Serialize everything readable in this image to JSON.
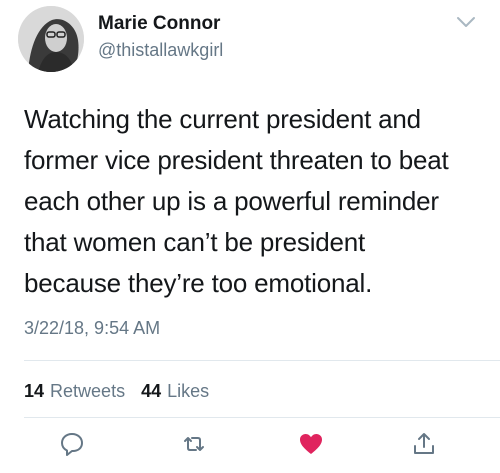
{
  "user": {
    "display_name": "Marie Connor",
    "handle": "@thistallawkgirl",
    "avatar_icon": "profile-photo"
  },
  "tweet": {
    "lines": [
      "Watching the current president and",
      "former vice president threaten to beat",
      "each other up is a powerful reminder",
      "that women can’t be president",
      "because they’re too emotional."
    ],
    "timestamp": "3/22/18, 9:54 AM"
  },
  "stats": {
    "retweets_count": "14",
    "retweets_label": "Retweets",
    "likes_count": "44",
    "likes_label": "Likes"
  },
  "actions": [
    {
      "name": "reply-icon"
    },
    {
      "name": "retweet-icon"
    },
    {
      "name": "like-icon",
      "color": "#e0245e"
    },
    {
      "name": "share-icon"
    }
  ],
  "colors": {
    "secondary_text": "#657786",
    "primary_text": "#14171a",
    "like": "#e0245e",
    "icon_gray": "#657786"
  }
}
